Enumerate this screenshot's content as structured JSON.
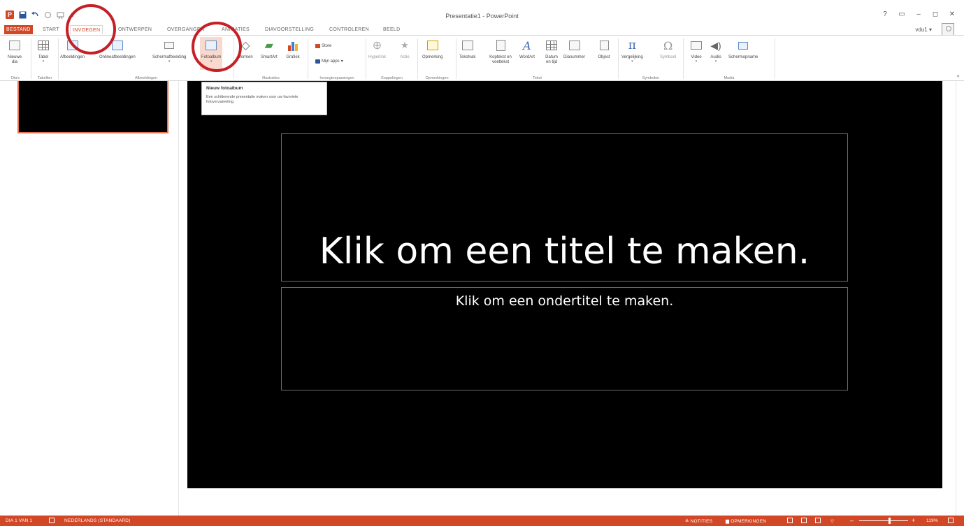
{
  "window": {
    "title": "Presentatie1 - PowerPoint",
    "controls": [
      "?",
      "▭",
      "–",
      "◻",
      "✕"
    ],
    "user": "vdu1 ▾"
  },
  "qat": {
    "app_icon": "P",
    "save_icon": "save-icon",
    "undo_icon": "undo-icon",
    "redo_icon": "redo-icon",
    "customize": "▾"
  },
  "tabs": [
    {
      "label": "BESTAND",
      "state": "file"
    },
    {
      "label": "START",
      "state": "normal"
    },
    {
      "label": "INVOEGEN",
      "state": "active"
    },
    {
      "label": "ONTWERPEN",
      "state": "normal"
    },
    {
      "label": "OVERGANGEN",
      "state": "normal"
    },
    {
      "label": "ANIMATIES",
      "state": "normal"
    },
    {
      "label": "DIAVOORSTELLING",
      "state": "normal"
    },
    {
      "label": "CONTROLEREN",
      "state": "normal"
    },
    {
      "label": "BEELD",
      "state": "normal"
    }
  ],
  "ribbon": {
    "groups": [
      {
        "label": "Dia's"
      },
      {
        "label": "Tabellen"
      },
      {
        "label": "Afbeeldingen"
      },
      {
        "label": "Illustraties"
      },
      {
        "label": "Invoegtoepassingen"
      },
      {
        "label": "Koppelingen"
      },
      {
        "label": "Opmerkingen"
      },
      {
        "label": "Tekst"
      },
      {
        "label": "Symbolen"
      },
      {
        "label": "Media"
      }
    ],
    "buttons": {
      "nieuwe_dia": "Nieuwe dia",
      "tabel": "Tabel",
      "afbeeldingen": "Afbeeldingen",
      "onlineafbeeldingen": "Onlineafbeeldingen",
      "schermafbeelding": "Schermafbeelding",
      "fotoalbum": "Fotoalbum",
      "vormen": "Vormen",
      "smartart": "SmartArt",
      "grafiek": "Grafiek",
      "store": "Store",
      "mijn_apps": "Mijn apps",
      "hyperlink": "Hyperlink",
      "actie": "Actie",
      "opmerking": "Opmerking",
      "tekstvak": "Tekstvak",
      "koptekst": "Koptekst en voettekst",
      "wordart": "WordArt",
      "datum": "Datum en tijd",
      "dianummer": "Dianummer",
      "object": "Object",
      "vergelijking": "Vergelijking",
      "symbool": "Symbool",
      "video": "Video",
      "audio": "Audio",
      "schermopname": "Schermopname"
    }
  },
  "tooltip": {
    "title": "Nieuw fotoalbum",
    "description": "Een schitterende presentatie maken voor uw favoriete fotoverzameling."
  },
  "slide": {
    "title_placeholder": "Klik om een titel te maken.",
    "subtitle_placeholder": "Klik om een ondertitel te maken."
  },
  "statusbar": {
    "slide_info": "DIA 1 VAN 1",
    "language": "NEDERLANDS (STANDAARD)",
    "notes": "NOTITIES",
    "comments": "OPMERKINGEN",
    "zoom": "119%",
    "zoom_minus": "–",
    "zoom_plus": "+"
  },
  "colors": {
    "accent": "#d24726",
    "annotation": "#c42026",
    "slide_bg": "#000000"
  }
}
